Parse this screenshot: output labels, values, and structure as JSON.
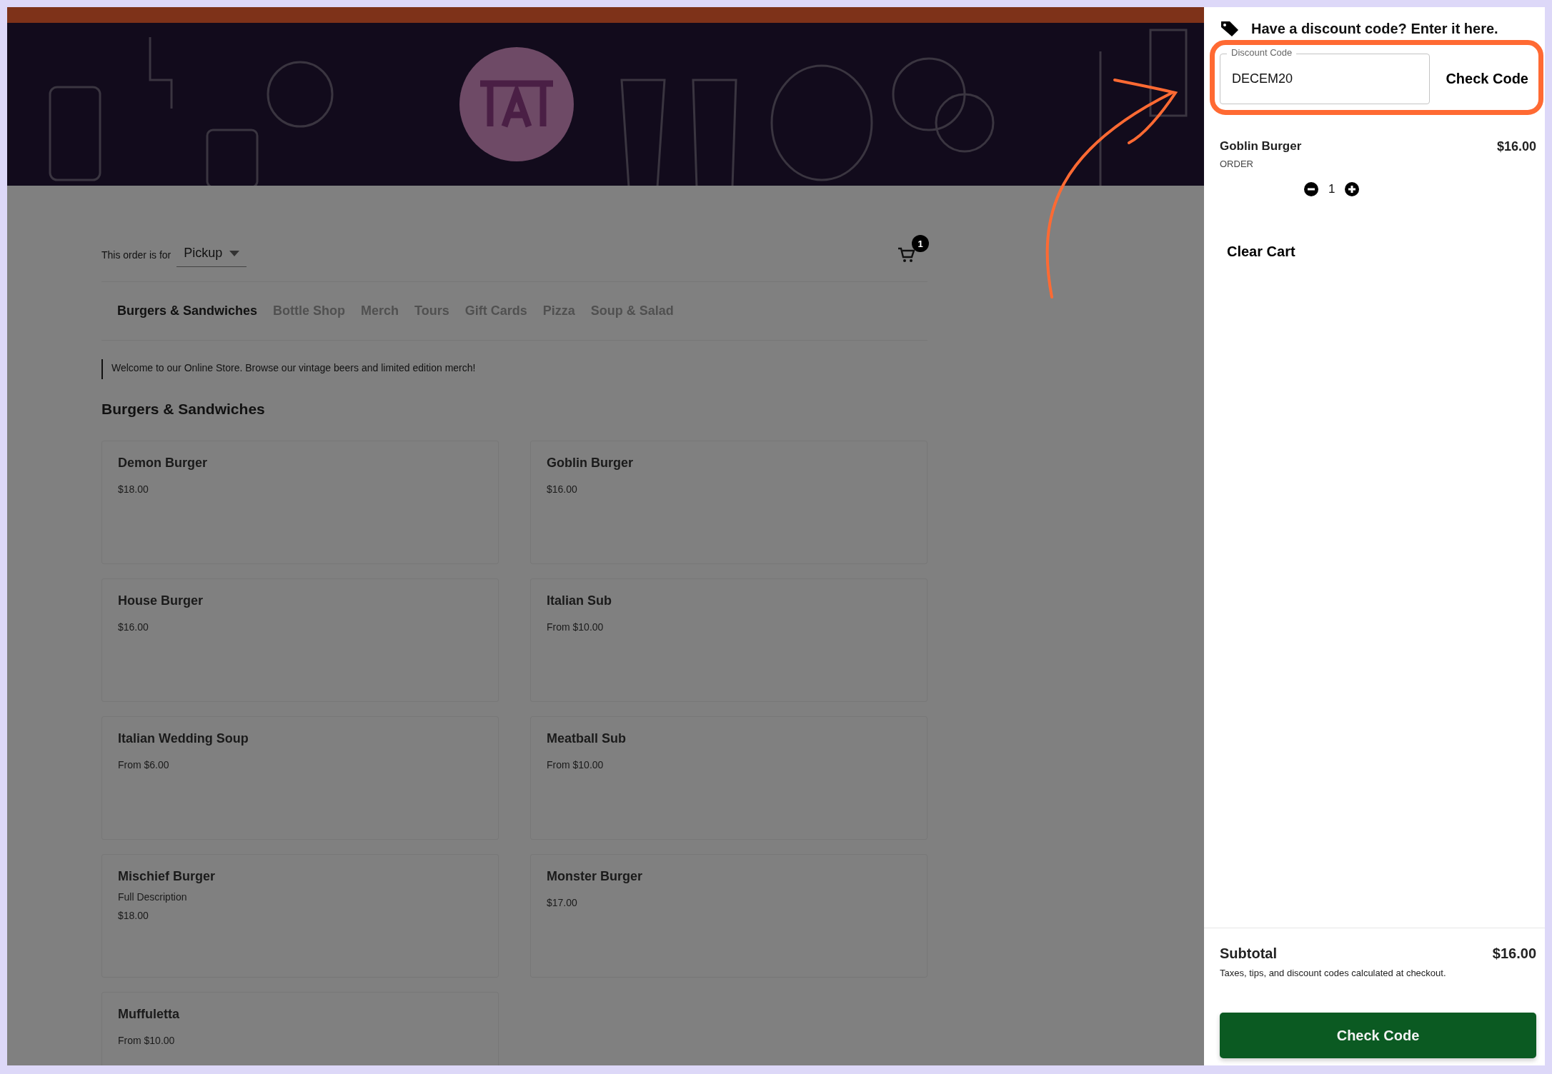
{
  "order_type": {
    "label": "This order is for",
    "value": "Pickup"
  },
  "cart": {
    "count": "1"
  },
  "tabs": [
    {
      "label": "Burgers & Sandwiches",
      "selected": true
    },
    {
      "label": "Bottle Shop",
      "selected": false
    },
    {
      "label": "Merch",
      "selected": false
    },
    {
      "label": "Tours",
      "selected": false
    },
    {
      "label": "Gift Cards",
      "selected": false
    },
    {
      "label": "Pizza",
      "selected": false
    },
    {
      "label": "Soup & Salad",
      "selected": false
    }
  ],
  "welcome_note": "Welcome to our Online Store. Browse our vintage beers and limited edition merch!",
  "section_title": "Burgers & Sandwiches",
  "products": [
    {
      "name": "Demon Burger",
      "price": "$18.00"
    },
    {
      "name": "Goblin Burger",
      "price": "$16.00"
    },
    {
      "name": "House Burger",
      "price": "$16.00"
    },
    {
      "name": "Italian Sub",
      "price": "From $10.00"
    },
    {
      "name": "Italian Wedding Soup",
      "price": "From $6.00"
    },
    {
      "name": "Meatball Sub",
      "price": "From $10.00"
    },
    {
      "name": "Mischief Burger",
      "description": "Full Description",
      "price": "$18.00"
    },
    {
      "name": "Monster Burger",
      "price": "$17.00"
    },
    {
      "name": "Muffuletta",
      "price": "From $10.00"
    }
  ],
  "cart_panel": {
    "discount_heading": "Have a discount code? Enter it here.",
    "discount_field": {
      "label": "Discount Code",
      "value": "DECEM20"
    },
    "check_code_link": "Check Code",
    "items": [
      {
        "name": "Goblin Burger",
        "type": "ORDER",
        "price": "$16.00",
        "quantity": "1"
      }
    ],
    "clear_cart": "Clear Cart",
    "subtotal_label": "Subtotal",
    "subtotal": "$16.00",
    "subtotal_note": "Taxes, tips, and discount codes calculated at checkout.",
    "primary_button": "Check Code"
  }
}
